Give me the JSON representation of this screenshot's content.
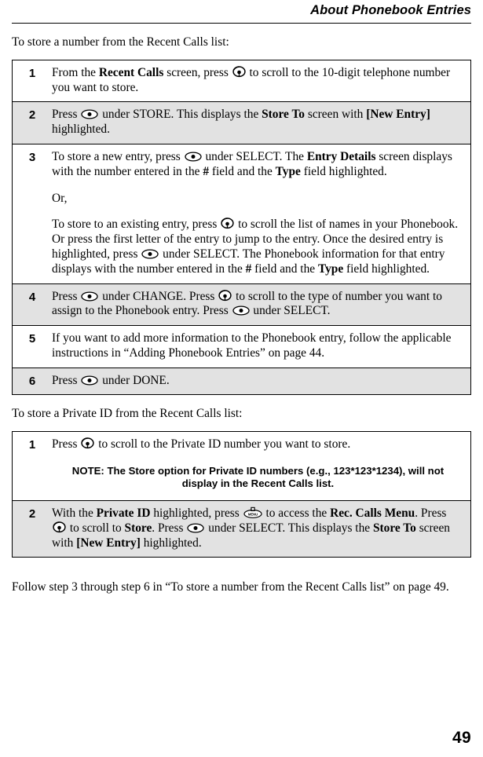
{
  "header": {
    "title": "About Phonebook Entries"
  },
  "sections": [
    {
      "lead": "To store a number from the Recent Calls list:",
      "steps": [
        {
          "number": "1",
          "shaded": false,
          "paragraphs": [
            [
              {
                "t": "text",
                "v": "From the "
              },
              {
                "t": "bold",
                "v": "Recent Calls"
              },
              {
                "t": "text",
                "v": " screen, press "
              },
              {
                "t": "icon",
                "v": "nav-scroll-key-icon"
              },
              {
                "t": "text",
                "v": " to scroll to the 10-digit telephone number you want to store."
              }
            ]
          ]
        },
        {
          "number": "2",
          "shaded": true,
          "paragraphs": [
            [
              {
                "t": "text",
                "v": "Press "
              },
              {
                "t": "icon",
                "v": "select-key-icon"
              },
              {
                "t": "text",
                "v": " under STORE. This displays the "
              },
              {
                "t": "bold",
                "v": "Store To"
              },
              {
                "t": "text",
                "v": " screen with "
              },
              {
                "t": "bold",
                "v": "[New Entry]"
              },
              {
                "t": "text",
                "v": " highlighted."
              }
            ]
          ]
        },
        {
          "number": "3",
          "shaded": false,
          "paragraphs": [
            [
              {
                "t": "text",
                "v": "To store a new entry, press "
              },
              {
                "t": "icon",
                "v": "select-key-icon"
              },
              {
                "t": "text",
                "v": " under SELECT. The "
              },
              {
                "t": "bold",
                "v": "Entry Details"
              },
              {
                "t": "text",
                "v": " screen displays with the number entered in the "
              },
              {
                "t": "bold",
                "v": "#"
              },
              {
                "t": "text",
                "v": " field and the "
              },
              {
                "t": "bold",
                "v": "Type"
              },
              {
                "t": "text",
                "v": " field highlighted."
              }
            ],
            [
              {
                "t": "text",
                "v": "Or,"
              }
            ],
            [
              {
                "t": "text",
                "v": "To store to an existing entry, press "
              },
              {
                "t": "icon",
                "v": "nav-scroll-key-icon"
              },
              {
                "t": "text",
                "v": " to scroll the list of names in your Phonebook. Or press the first letter of the entry to jump to the entry. Once the desired entry is highlighted, press "
              },
              {
                "t": "icon",
                "v": "select-key-icon"
              },
              {
                "t": "text",
                "v": " under SELECT. The Phonebook information for that entry displays with the number entered in the "
              },
              {
                "t": "bold",
                "v": "#"
              },
              {
                "t": "text",
                "v": " field and the "
              },
              {
                "t": "bold",
                "v": "Type"
              },
              {
                "t": "text",
                "v": " field highlighted."
              }
            ]
          ]
        },
        {
          "number": "4",
          "shaded": true,
          "paragraphs": [
            [
              {
                "t": "text",
                "v": "Press "
              },
              {
                "t": "icon",
                "v": "select-key-icon"
              },
              {
                "t": "text",
                "v": " under CHANGE. Press "
              },
              {
                "t": "icon",
                "v": "nav-scroll-key-icon"
              },
              {
                "t": "text",
                "v": " to scroll to the type of number you want to assign to the Phonebook entry. Press "
              },
              {
                "t": "icon",
                "v": "select-key-icon"
              },
              {
                "t": "text",
                "v": " under SELECT."
              }
            ]
          ]
        },
        {
          "number": "5",
          "shaded": false,
          "paragraphs": [
            [
              {
                "t": "text",
                "v": "If you want to add more information to the Phonebook entry, follow the applicable instructions in “Adding Phonebook Entries” on page 44."
              }
            ]
          ]
        },
        {
          "number": "6",
          "shaded": true,
          "paragraphs": [
            [
              {
                "t": "text",
                "v": "Press "
              },
              {
                "t": "icon",
                "v": "select-key-icon"
              },
              {
                "t": "text",
                "v": " under DONE."
              }
            ]
          ]
        }
      ]
    },
    {
      "lead": "To store a Private ID from the Recent Calls list:",
      "steps": [
        {
          "number": "1",
          "shaded": false,
          "paragraphs": [
            [
              {
                "t": "text",
                "v": "Press "
              },
              {
                "t": "icon",
                "v": "nav-scroll-key-icon"
              },
              {
                "t": "text",
                "v": " to scroll to the Private ID number you want to store."
              }
            ]
          ],
          "note": "NOTE: The Store option for Private ID numbers (e.g., 123*123*1234), will not display in the Recent Calls list."
        },
        {
          "number": "2",
          "shaded": true,
          "paragraphs": [
            [
              {
                "t": "text",
                "v": "With the "
              },
              {
                "t": "bold",
                "v": "Private ID"
              },
              {
                "t": "text",
                "v": " highlighted, press "
              },
              {
                "t": "icon",
                "v": "menu-key-icon"
              },
              {
                "t": "text",
                "v": " to access the "
              },
              {
                "t": "bold",
                "v": "Rec. Calls Menu"
              },
              {
                "t": "text",
                "v": ". Press "
              },
              {
                "t": "icon",
                "v": "nav-scroll-key-icon"
              },
              {
                "t": "text",
                "v": " to scroll to "
              },
              {
                "t": "bold",
                "v": "Store"
              },
              {
                "t": "text",
                "v": ". Press "
              },
              {
                "t": "icon",
                "v": "select-key-icon"
              },
              {
                "t": "text",
                "v": " under SELECT. This displays the "
              },
              {
                "t": "bold",
                "v": "Store To"
              },
              {
                "t": "text",
                "v": " screen with "
              },
              {
                "t": "bold",
                "v": "[New Entry]"
              },
              {
                "t": "text",
                "v": " highlighted."
              }
            ]
          ]
        }
      ]
    }
  ],
  "closing": "Follow step 3 through step 6 in “To store a number from the Recent Calls list” on page 49.",
  "folio": "49",
  "colors": {
    "page_background": "#ffffff",
    "text": "#000000",
    "row_shading": "#e2e2e2",
    "rule": "#000000"
  }
}
